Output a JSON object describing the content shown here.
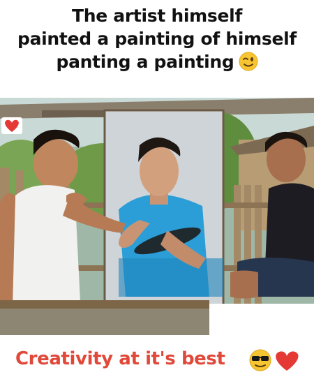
{
  "caption": {
    "line1": "The artist himself",
    "line2": "painted a painting of himself",
    "line3": "panting a painting"
  },
  "footer": {
    "text": "Creativity at it's best"
  },
  "icons": {
    "caption_emoji": "winking-face-icon",
    "corner": "heart-icon",
    "footer_emoji_1": "sunglasses-face-icon",
    "footer_emoji_2": "heart-icon"
  },
  "colors": {
    "footer_text": "#e0493a",
    "heart": "#e53935"
  }
}
